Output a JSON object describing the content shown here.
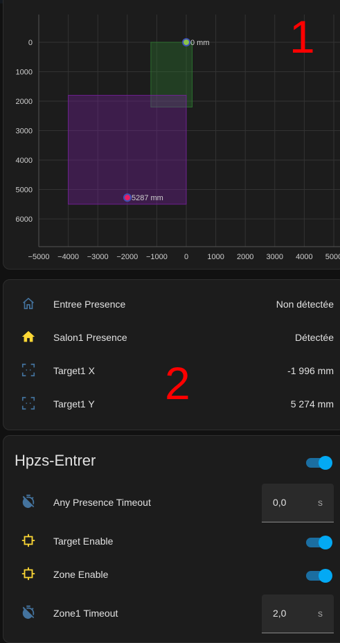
{
  "annotations": {
    "one": "1",
    "two": "2"
  },
  "chart_data": {
    "type": "scatter",
    "title": "",
    "xlabel": "",
    "ylabel": "",
    "xlim": [
      -5000,
      5000
    ],
    "ylim": [
      0,
      6500
    ],
    "y_inverted": true,
    "grid": true,
    "x_ticks": [
      "−5000",
      "−4000",
      "−3000",
      "−2000",
      "−1000",
      "0",
      "1000",
      "2000",
      "3000",
      "4000",
      "5000"
    ],
    "x_tick_values": [
      -5000,
      -4000,
      -3000,
      -2000,
      -1000,
      0,
      1000,
      2000,
      3000,
      4000,
      5000
    ],
    "y_ticks": [
      "0",
      "1000",
      "2000",
      "3000",
      "4000",
      "5000",
      "6000"
    ],
    "y_tick_values": [
      0,
      1000,
      2000,
      3000,
      4000,
      5000,
      6000
    ],
    "zones": [
      {
        "x1": -1200,
        "y1": 0,
        "x2": 200,
        "y2": 2200,
        "color": "#2e7d32"
      },
      {
        "x1": -4000,
        "y1": 1800,
        "x2": 0,
        "y2": 5500,
        "color": "#7b1fa2"
      }
    ],
    "points": [
      {
        "x": 0,
        "y": 0,
        "label": "0 mm",
        "color": "#8bc34a"
      },
      {
        "x": -1996,
        "y": 5274,
        "label": "5287 mm",
        "color": "#e91e63"
      }
    ]
  },
  "sensors": [
    {
      "name": "Entree Presence",
      "value": "Non détectée",
      "icon": "home-outline-icon"
    },
    {
      "name": "Salon1 Presence",
      "value": "Détectée",
      "icon": "home-filled-icon"
    },
    {
      "name": "Target1 X",
      "value": "-1 996 mm",
      "icon": "target-frame-icon"
    },
    {
      "name": "Target1 Y",
      "value": "5 274 mm",
      "icon": "target-frame-icon"
    }
  ],
  "device": {
    "title": "Hpzs-Entrer",
    "main_toggle_on": true,
    "any_presence_timeout": {
      "label": "Any Presence Timeout",
      "value": "0,0",
      "unit": "s",
      "icon": "timer-off-icon"
    },
    "target_enable": {
      "label": "Target Enable",
      "on": true,
      "icon": "target-zone-icon"
    },
    "zone_enable": {
      "label": "Zone Enable",
      "on": true,
      "icon": "target-zone-icon"
    },
    "zone1_timeout": {
      "label": "Zone1 Timeout",
      "value": "2,0",
      "unit": "s",
      "icon": "timer-off-icon"
    }
  },
  "colors": {
    "accent": "#03a9f4",
    "icon_blue": "#44739e",
    "icon_yellow": "#fdd835",
    "annotation": "#ff0000"
  }
}
